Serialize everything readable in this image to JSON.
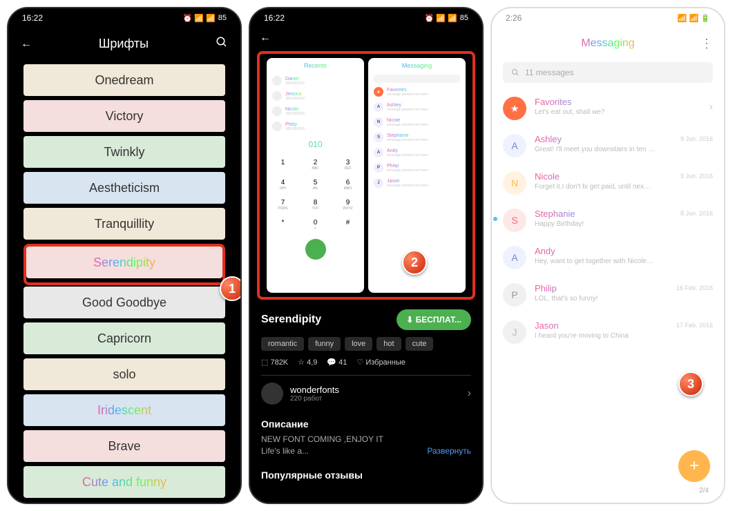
{
  "status": {
    "time1": "16:22",
    "time2": "16:22",
    "time3": "2:26",
    "battery": "85"
  },
  "p1": {
    "title": "Шрифты",
    "fonts": [
      {
        "name": "Onedream",
        "cls": "bg-tan"
      },
      {
        "name": "Victory",
        "cls": "bg-pink"
      },
      {
        "name": "Twinkly",
        "cls": "bg-green"
      },
      {
        "name": "Aestheticism",
        "cls": "bg-blue"
      },
      {
        "name": "Tranquillity",
        "cls": "bg-tan"
      },
      {
        "name": "Serendipity",
        "cls": "bg-pink",
        "colorful": true,
        "selected": true
      },
      {
        "name": "Good Goodbye",
        "cls": "bg-grey"
      },
      {
        "name": "Capricorn",
        "cls": "bg-green"
      },
      {
        "name": "solo",
        "cls": "bg-tan"
      },
      {
        "name": "Iridescent",
        "cls": "bg-blue",
        "colorful": true
      },
      {
        "name": "Brave",
        "cls": "bg-pink"
      },
      {
        "name": "Cute and funny",
        "cls": "bg-green",
        "colorful": true
      }
    ]
  },
  "p2": {
    "name": "Serendipity",
    "download": "БЕСПЛАТ...",
    "tags": [
      "romantic",
      "funny",
      "love",
      "hot",
      "cute"
    ],
    "stats": {
      "downloads": "782K",
      "rating": "4,9",
      "comments": "41",
      "fav": "Избранные"
    },
    "author": {
      "name": "wonderfonts",
      "works": "220 работ"
    },
    "desc_title": "Описание",
    "desc": "NEW FONT COMING ,ENJOY IT\nLife's like a...",
    "expand": "Развернуть",
    "reviews_title": "Популярные отзывы",
    "preview_left": {
      "title": "Recents",
      "contacts": [
        "Daniel",
        "Jessica",
        "Nicole",
        "Philip"
      ],
      "number": "010",
      "keys": [
        [
          "1",
          ""
        ],
        [
          "2",
          "ABC"
        ],
        [
          "3",
          "DEF"
        ],
        [
          "4",
          "GHI"
        ],
        [
          "5",
          "JKL"
        ],
        [
          "6",
          "MNO"
        ],
        [
          "7",
          "PQRS"
        ],
        [
          "8",
          "TUV"
        ],
        [
          "9",
          "WXYZ"
        ],
        [
          "*",
          ""
        ],
        [
          "0",
          "+"
        ],
        [
          "#",
          ""
        ]
      ]
    },
    "preview_right": {
      "title": "Messaging",
      "items": [
        "Favorites",
        "Ashley",
        "Nicole",
        "Stephanie",
        "Andy",
        "Philip",
        "Jason"
      ]
    }
  },
  "p3": {
    "title": "Messaging",
    "search": "11 messages",
    "items": [
      {
        "av": "★",
        "cls": "av-star",
        "name": "Favorites",
        "text": "Let's eat out, shall we?",
        "date": "",
        "chevron": true
      },
      {
        "av": "A",
        "cls": "av-a",
        "name": "Ashley",
        "text": "Great! I'll meet you downstairs in ten …",
        "date": "9 Jun. 2016"
      },
      {
        "av": "N",
        "cls": "av-n",
        "name": "Nicole",
        "text": "Forget it.I don't bi get paid, until nex…",
        "date": "9 Jun. 2016"
      },
      {
        "av": "S",
        "cls": "av-s",
        "name": "Stephanie",
        "text": "Happy Birthday!",
        "date": "8 Jun. 2016",
        "unread": true
      },
      {
        "av": "A",
        "cls": "av-a",
        "name": "Andy",
        "text": "Hey, want to get together with Nicole…",
        "date": ""
      },
      {
        "av": "P",
        "cls": "av-p",
        "name": "Philip",
        "text": "LOL, that's so funny!",
        "date": "16 Feb. 2016"
      },
      {
        "av": "J",
        "cls": "av-j",
        "name": "Jason",
        "text": "I heard you're moving to China",
        "date": "17 Feb. 2016"
      }
    ],
    "pager": "2/4"
  },
  "steps": {
    "s1": "1",
    "s2": "2",
    "s3": "3"
  }
}
